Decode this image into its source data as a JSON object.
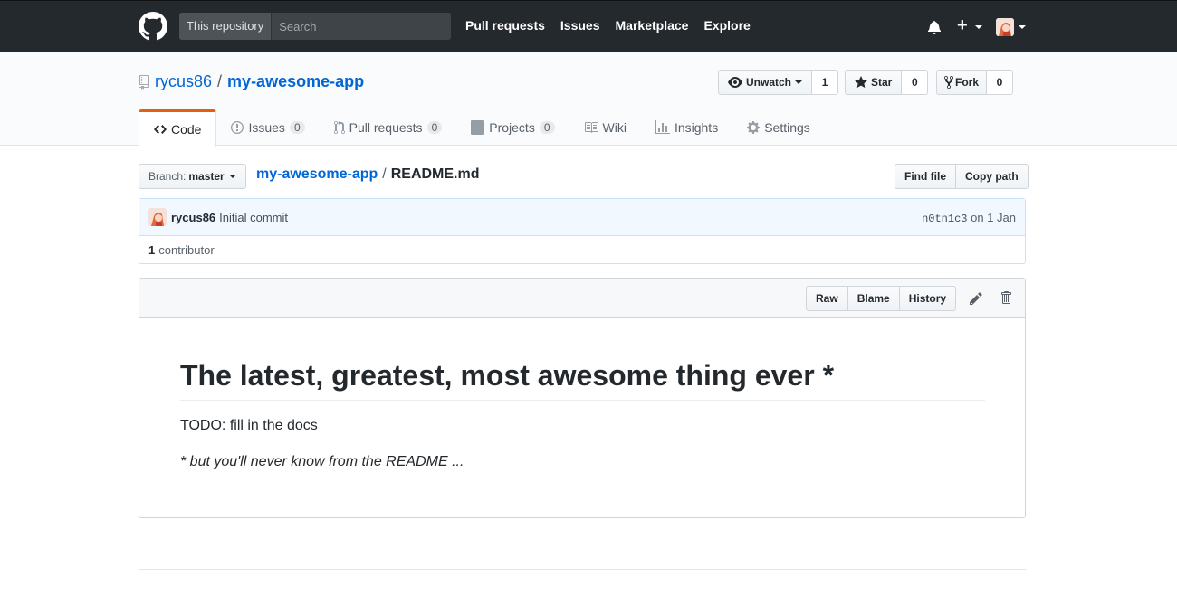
{
  "header": {
    "search_scope": "This repository",
    "search_placeholder": "Search",
    "nav": [
      "Pull requests",
      "Issues",
      "Marketplace",
      "Explore"
    ],
    "plus": "+"
  },
  "repo": {
    "owner": "rycus86",
    "separator": "/",
    "name": "my-awesome-app",
    "actions": {
      "watch_label": "Unwatch",
      "watch_count": "1",
      "star_label": "Star",
      "star_count": "0",
      "fork_label": "Fork",
      "fork_count": "0"
    },
    "tabs": [
      {
        "label": "Code",
        "count": null,
        "icon": "code-icon"
      },
      {
        "label": "Issues",
        "count": "0",
        "icon": "issue-icon"
      },
      {
        "label": "Pull requests",
        "count": "0",
        "icon": "pull-request-icon"
      },
      {
        "label": "Projects",
        "count": "0",
        "icon": "project-icon"
      },
      {
        "label": "Wiki",
        "count": null,
        "icon": "book-icon"
      },
      {
        "label": "Insights",
        "count": null,
        "icon": "graph-icon"
      },
      {
        "label": "Settings",
        "count": null,
        "icon": "gear-icon"
      }
    ]
  },
  "file_nav": {
    "branch_prefix": "Branch:",
    "branch": "master",
    "breadcrumb_root": "my-awesome-app",
    "breadcrumb_sep": "/",
    "filename": "README.md",
    "find_file": "Find file",
    "copy_path": "Copy path"
  },
  "commit": {
    "author": "rycus86",
    "message": "Initial commit",
    "sha": "n0tn1c3",
    "date_text": "on 1 Jan",
    "contributor_count": "1",
    "contributor_label": "contributor"
  },
  "file_actions": {
    "raw": "Raw",
    "blame": "Blame",
    "history": "History"
  },
  "readme": {
    "heading": "The latest, greatest, most awesome thing ever *",
    "body": "TODO: fill in the docs",
    "footnote": "* but you'll never know from the README ..."
  },
  "colors": {
    "header_bg": "#24292e",
    "link": "#0366d6",
    "selected_tab_accent": "#e36209"
  }
}
